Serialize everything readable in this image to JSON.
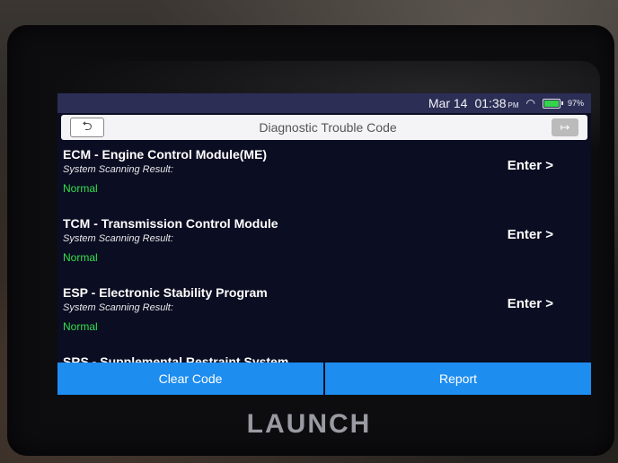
{
  "status_bar": {
    "date": "Mar 14",
    "time": "01:38",
    "ampm": "PM",
    "battery_pct": "97%",
    "battery_level": 0.97,
    "wifi_icon": "wifi-icon"
  },
  "header": {
    "title": "Diagnostic Trouble Code",
    "back_icon": "back-arrow-icon",
    "exit_icon": "exit-icon"
  },
  "systems": [
    {
      "name": "ECM - Engine Control Module(ME)",
      "sub": "System Scanning Result:",
      "status": "Normal",
      "action": "Enter >"
    },
    {
      "name": "TCM - Transmission Control Module",
      "sub": "System Scanning Result:",
      "status": "Normal",
      "action": "Enter >"
    },
    {
      "name": "ESP - Electronic Stability Program",
      "sub": "System Scanning Result:",
      "status": "Normal",
      "action": "Enter >"
    },
    {
      "name": "SRS - Supplemental Restraint System"
    }
  ],
  "footer": {
    "clear_label": "Clear Code",
    "report_label": "Report"
  },
  "brand": "LAUNCH",
  "colors": {
    "accent": "#1e8df0",
    "status_normal": "#33e04a",
    "screen_bg": "#0b0d22"
  }
}
